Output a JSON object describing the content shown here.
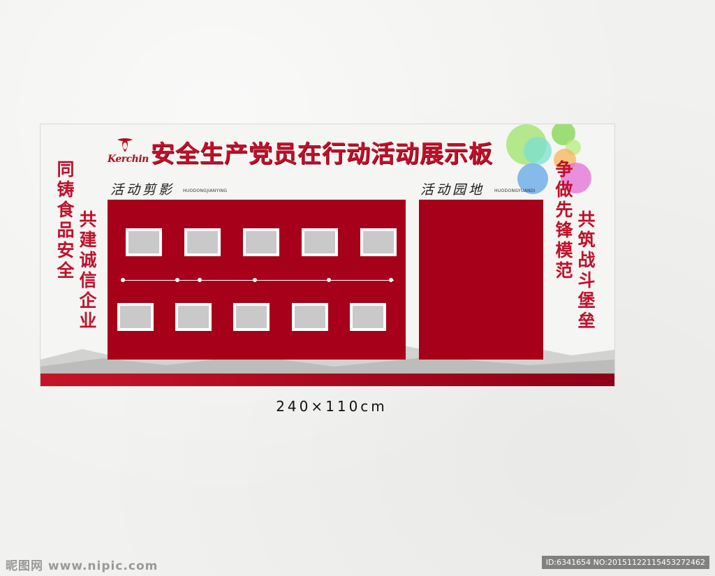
{
  "board": {
    "title": "安全生产党员在行动活动展示板",
    "logo_text": "Kerchin",
    "left_slogan_1": "同铸食品安全",
    "left_slogan_2": "共建诚信企业",
    "right_slogan_1": "争做先锋模范",
    "right_slogan_2": "共筑战斗堡垒",
    "section_1": {
      "label": "活动剪影",
      "sub": "HUODONGJIANYING"
    },
    "section_2": {
      "label": "活动园地",
      "sub": "HUODONGYUANDI"
    }
  },
  "size_label": "240×110cm",
  "watermark": {
    "left": "昵图网 www.nipic.com",
    "right": "ID:6341654 NO:20151122115453272462"
  },
  "colors": {
    "accent": "#c0102a",
    "panel": "#a6001a"
  }
}
